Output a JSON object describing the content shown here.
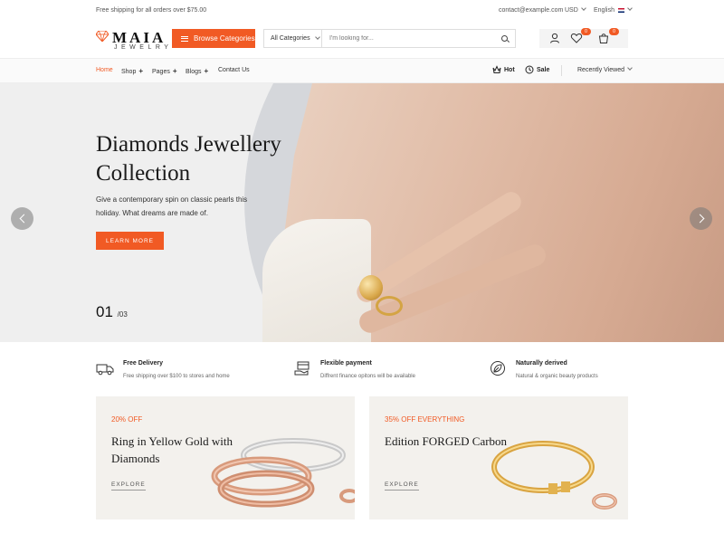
{
  "topbar": {
    "shipping_text": "Free shipping for all orders over $75.00",
    "email": "contact@example.com",
    "currency": "USD",
    "language": "English"
  },
  "header": {
    "brand": "MAIA",
    "brand_sub": "JEWELRY",
    "browse_label": "Browse Categories",
    "search_category": "All Categories",
    "search_placeholder": "I'm looking for...",
    "wishlist_count": "0",
    "cart_count": "0"
  },
  "nav": {
    "items": [
      {
        "label": "Home"
      },
      {
        "label": "Shop"
      },
      {
        "label": "Pages"
      },
      {
        "label": "Blogs"
      },
      {
        "label": "Contact Us"
      }
    ],
    "hot_label": "Hot",
    "sale_label": "Sale",
    "recent_label": "Recently Viewed"
  },
  "hero": {
    "title": "Diamonds Jewellery Collection",
    "text": "Give a contemporary spin on classic pearls this holiday. What dreams are made of.",
    "button_label": "LEARN MORE",
    "slide_current": "01",
    "slide_total": "/03"
  },
  "features": [
    {
      "title": "Free Delivery",
      "desc": "Free shipping over $100 to stores and home",
      "icon": "truck-icon"
    },
    {
      "title": "Flexible payment",
      "desc": "Diffrent finance opitons will be available",
      "icon": "payment-icon"
    },
    {
      "title": "Naturally derived",
      "desc": "Natural & organic beauty products",
      "icon": "leaf-icon"
    }
  ],
  "promos": [
    {
      "discount": "20% OFF",
      "title": "Ring in Yellow Gold with Diamonds",
      "link": "EXPLORE"
    },
    {
      "discount": "35% OFF EVERYTHING",
      "title": "Edition FORGED Carbon",
      "link": "EXPLORE"
    }
  ],
  "colors": {
    "accent": "#f15a24",
    "hero_bg": "#efefef",
    "promo_bg": "#f3f1ed"
  }
}
